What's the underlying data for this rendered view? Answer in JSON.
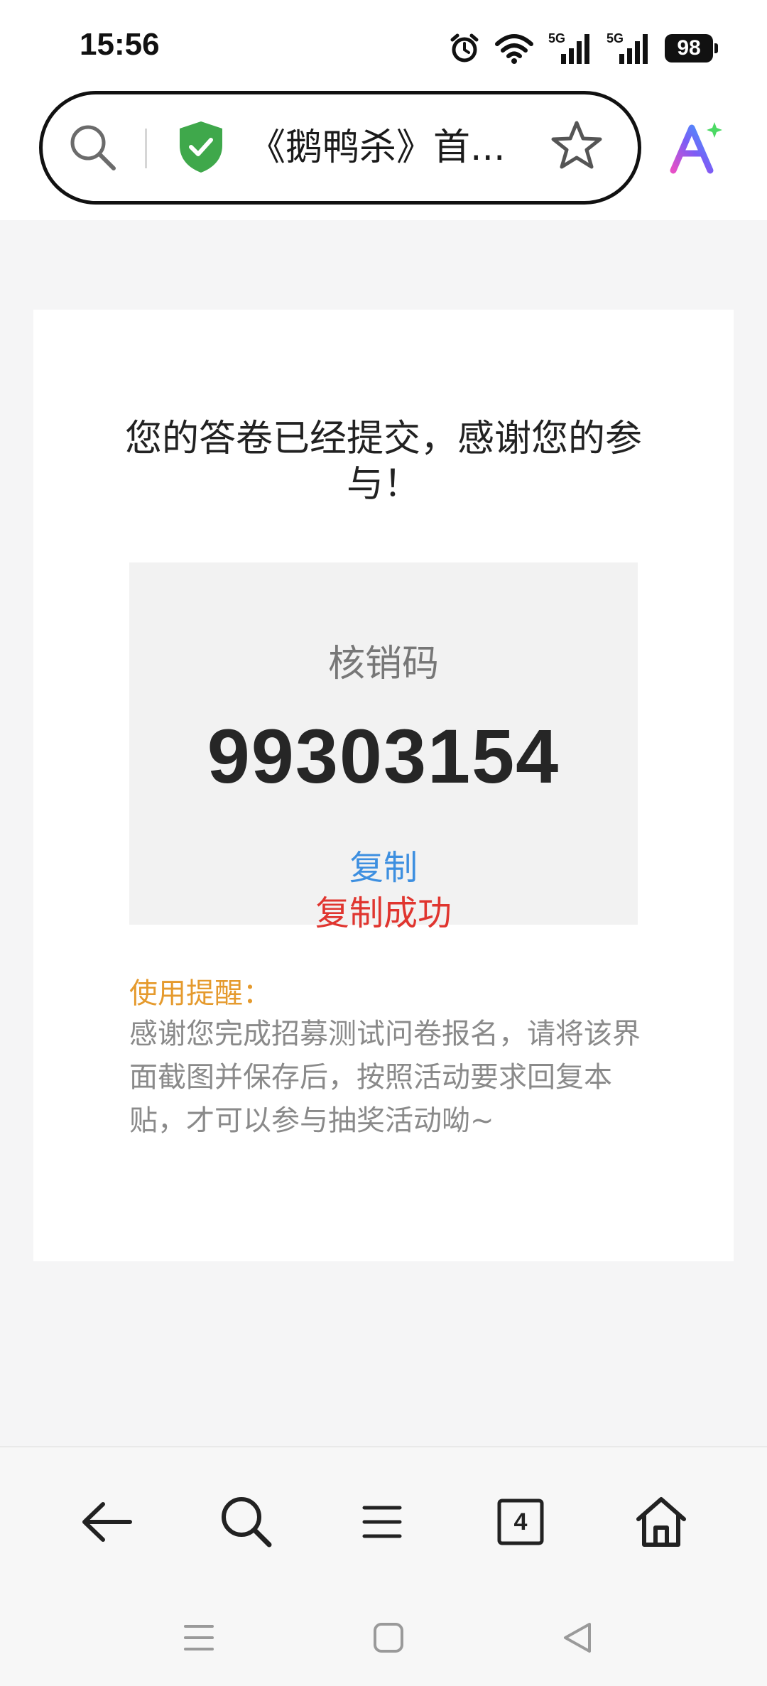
{
  "status_bar": {
    "time": "15:56",
    "network_1": "5G",
    "network_2": "5G",
    "battery": "98"
  },
  "browser": {
    "page_title": "《鹅鸭杀》首...",
    "icons": [
      "search-icon",
      "shield-check-icon",
      "star-icon",
      "ai-assistant-icon"
    ]
  },
  "content": {
    "heading": "您的答卷已经提交，感谢您的参与！",
    "code_label": "核销码",
    "code_value": "99303154",
    "copy_label": "复制",
    "copy_success": "复制成功",
    "tip_title": "使用提醒：",
    "tip_body": "感谢您完成招募测试问卷报名，请将该界面截图并保存后，按照活动要求回复本贴，才可以参与抽奖活动呦~"
  },
  "toolbar": {
    "tabs_count": "4",
    "icons": [
      "back-arrow-icon",
      "search-icon",
      "menu-icon",
      "tabs-icon",
      "home-icon"
    ]
  },
  "system_nav": {
    "icons": [
      "recent-apps-icon",
      "home-square-icon",
      "back-triangle-icon"
    ]
  },
  "colors": {
    "copy_link": "#3d8fe0",
    "copy_success": "#e0352f",
    "tip_title": "#e59a2d",
    "shield": "#3fa84b"
  }
}
